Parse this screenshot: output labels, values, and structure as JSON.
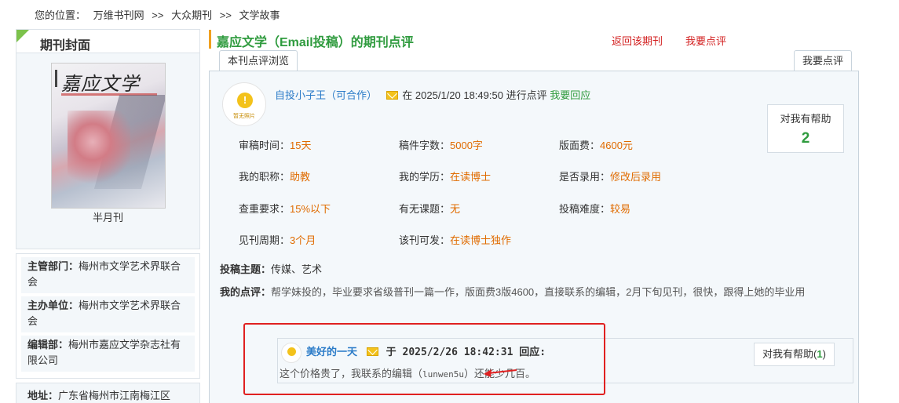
{
  "breadcrumb": {
    "label": "您的位置：",
    "items": [
      "万维书刊网",
      ">>",
      "大众期刊",
      ">>",
      "文学故事"
    ]
  },
  "sidebar": {
    "cover_title": "期刊封面",
    "cover_masthead": "嘉应文学",
    "cover_caption": "半月刊",
    "info": [
      {
        "key": "主管部门：",
        "value": "梅州市文学艺术界联合会"
      },
      {
        "key": "主办单位：",
        "value": "梅州市文学艺术界联合会"
      },
      {
        "key": "编辑部：",
        "value": "梅州市嘉应文学杂志社有限公司"
      }
    ],
    "address": {
      "key": "地址：",
      "value": "广东省梅州市江南梅江区"
    }
  },
  "main": {
    "title": "嘉应文学（Email投稿）的期刊点评",
    "links": {
      "back": "返回该期刊",
      "review": "我要点评"
    },
    "tabs": {
      "browse": "本刊点评浏览",
      "review": "我要点评"
    }
  },
  "review": {
    "avatar_caption": "暂无照片",
    "avatar_glyph": "!",
    "user": "自投小子王（可合作）",
    "at": "在",
    "datetime": "2025/1/20 18:49:50",
    "action": "进行点评",
    "reply_link": "我要回应",
    "helpful_label": "对我有帮助",
    "helpful_count": "2",
    "fields": [
      {
        "k": "审稿时间：",
        "v": "15天"
      },
      {
        "k": "稿件字数：",
        "v": "5000字"
      },
      {
        "k": "版面费：",
        "v": "4600元"
      },
      {
        "k": "我的职称：",
        "v": "助教"
      },
      {
        "k": "我的学历：",
        "v": "在读博士"
      },
      {
        "k": "是否录用：",
        "v": "修改后录用"
      },
      {
        "k": "查重要求：",
        "v": "15%以下"
      },
      {
        "k": "有无课题：",
        "v": "无"
      },
      {
        "k": "投稿难度：",
        "v": "较易"
      },
      {
        "k": "见刊周期：",
        "v": "3个月"
      },
      {
        "k": "该刊可发：",
        "v": "在读博士独作"
      }
    ],
    "topic_label": "投稿主题：",
    "topic": "传媒、艺术",
    "comment_label": "我的点评：",
    "comment": "帮学妹投的，毕业要求省级普刊一篇一作，版面费3版4600，直接联系的编辑，2月下旬见刊，很快，跟得上她的毕业用"
  },
  "reply": {
    "user": "美好的一天",
    "prefix": "于",
    "datetime": "2025/2/26 18:42:31",
    "suffix": "回应:",
    "text_before": "这个价格贵了，我联系的编辑（",
    "text_mono": "lunwen5u",
    "text_after": "）还能少几百。",
    "helpful_label": "对我有帮助(",
    "helpful_count": "1",
    "helpful_close": ")"
  },
  "colors": {
    "accent_green": "#2f9b3e",
    "link_blue": "#2b7bc8",
    "link_red": "#d32020",
    "value_orange": "#e06b00",
    "annotation_red": "#e02020"
  },
  "icons": [
    "mail-icon",
    "avatar-placeholder-icon",
    "red-arrow-annotation"
  ]
}
